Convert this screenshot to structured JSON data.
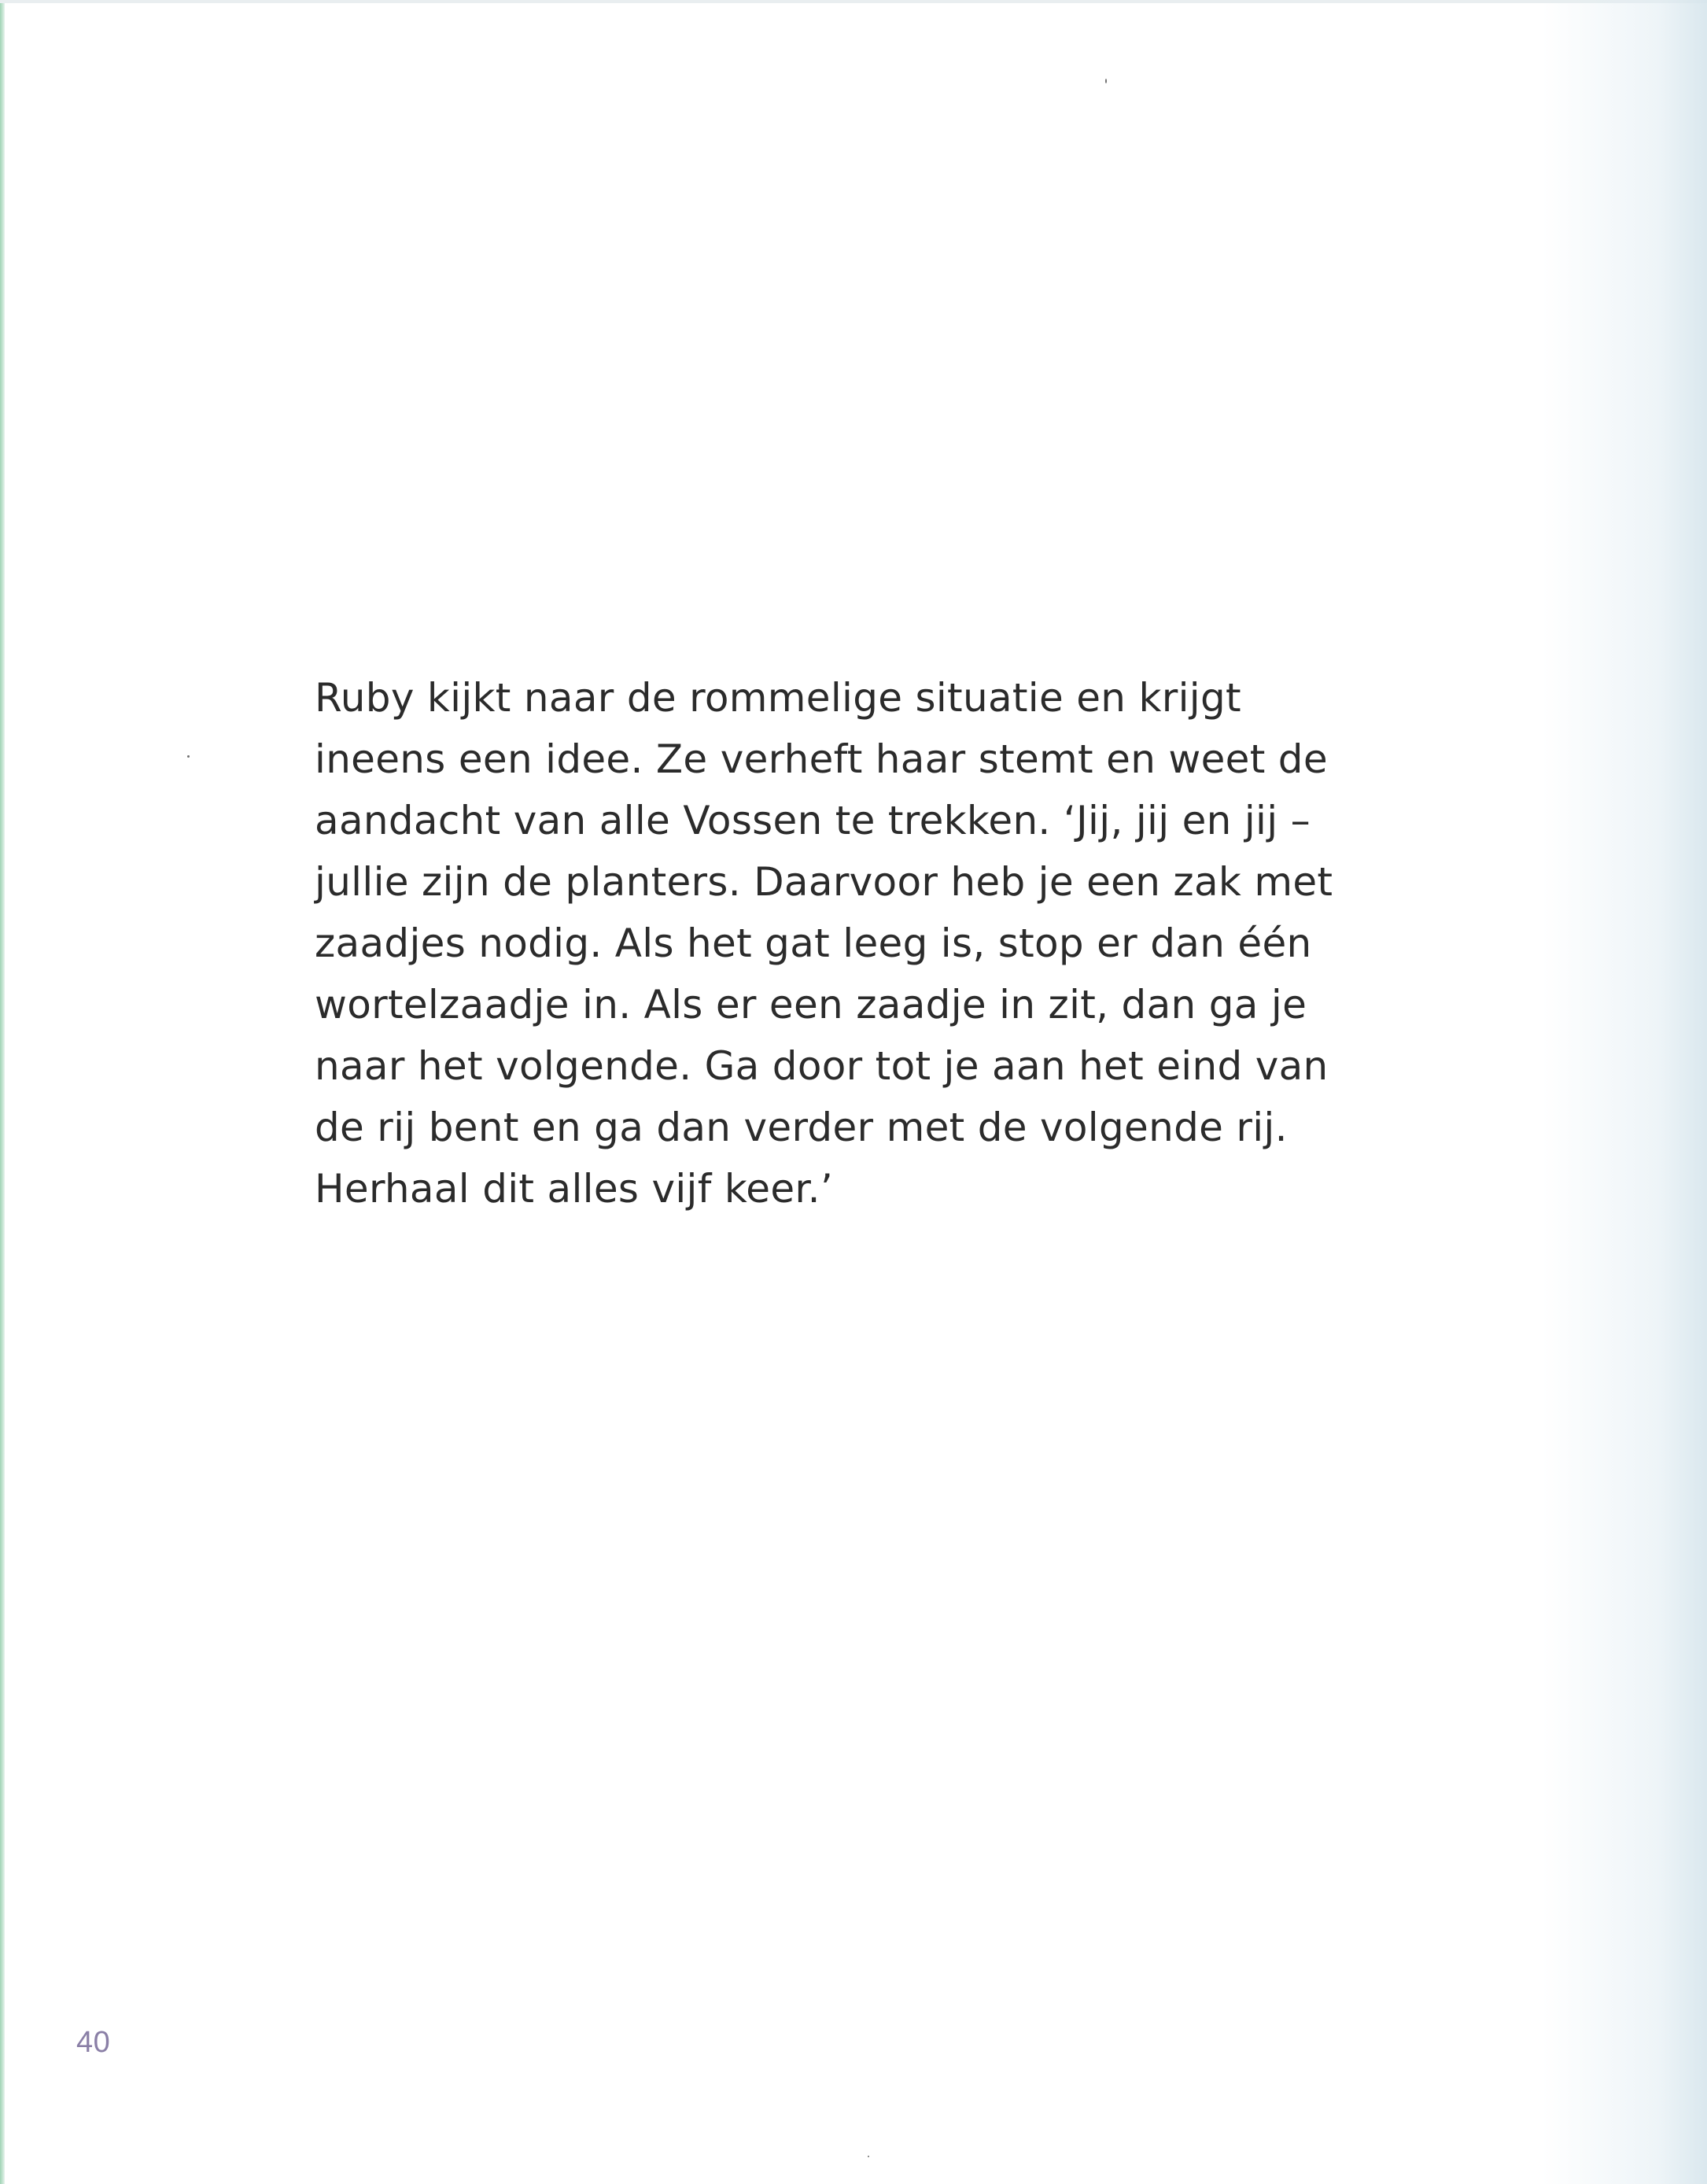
{
  "page": {
    "lines": [
      "Ruby kijkt naar de rommelige situatie en krijgt",
      "ineens een idee. Ze verheft haar stemt en weet de",
      "aandacht van alle Vossen te trekken. ‘Jij, jij en jij –",
      "jullie zijn de planters. Daarvoor heb je een zak met",
      "zaadjes nodig. Als het gat leeg is, stop er dan één",
      "wortelzaadje in. Als er een zaadje in zit, dan ga je",
      "naar het volgende. Ga door tot je aan het eind van",
      "de rij bent en ga dan verder met de volgende rij.",
      "Herhaal dit alles vijf keer.’"
    ],
    "page_number": "40"
  },
  "colors": {
    "text": "#2b2b2b",
    "page_number": "#8a7fa6",
    "edge_accent": "#9fd3b4"
  }
}
